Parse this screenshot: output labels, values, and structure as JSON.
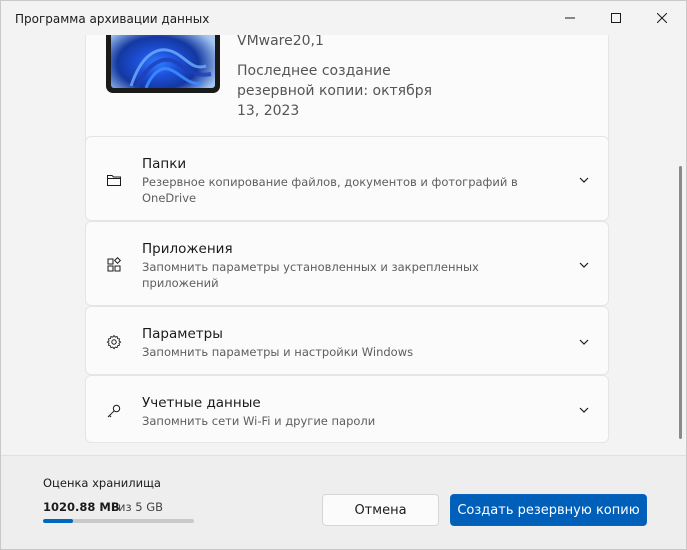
{
  "window": {
    "title": "Программа архивации данных"
  },
  "device": {
    "name": "VMware20,1",
    "last_backup": "Последнее создание резервной копии: октября 13, 2023"
  },
  "rows": [
    {
      "icon": "folder-icon",
      "title": "Папки",
      "description": "Резервное копирование файлов, документов и фотографий в OneDrive"
    },
    {
      "icon": "apps-icon",
      "title": "Приложения",
      "description": "Запомнить параметры установленных и закрепленных приложений"
    },
    {
      "icon": "gear-icon",
      "title": "Параметры",
      "description": "Запомнить параметры и настройки Windows"
    },
    {
      "icon": "key-icon",
      "title": "Учетные данные",
      "description": "Запомнить сети Wi-Fi и другие пароли"
    }
  ],
  "footer": {
    "storage_label": "Оценка хранилища",
    "storage_used": "1020.88 MB",
    "storage_total": "из 5 GB",
    "storage_fraction": 0.2,
    "cancel_label": "Отмена",
    "create_label": "Создать резервную копию"
  },
  "colors": {
    "accent": "#005fb8",
    "progress": "#0067c0"
  }
}
